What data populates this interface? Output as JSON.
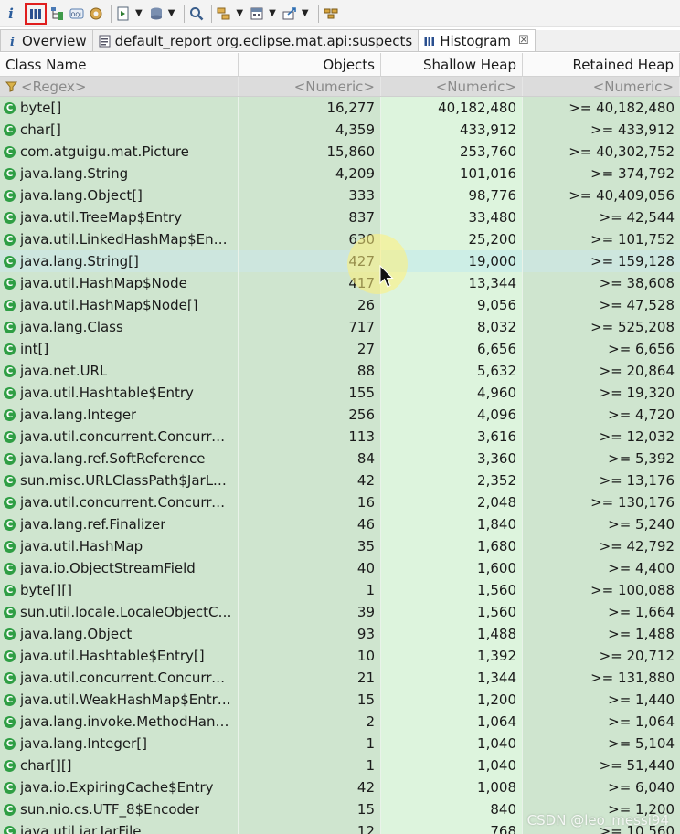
{
  "toolbar": {
    "info_label": "i",
    "buttons": [
      "histogram-icon",
      "dominator-tree-icon",
      "oql-icon",
      "settings-icon",
      "run-report-icon",
      "query-browser-icon",
      "search-icon",
      "group-icon",
      "calculator-icon",
      "export-icon",
      "overflow-icon"
    ]
  },
  "tabs": [
    {
      "label": "Overview",
      "icon": "info-icon"
    },
    {
      "label": "default_report  org.eclipse.mat.api:suspects",
      "icon": "report-icon"
    },
    {
      "label": "Histogram",
      "icon": "histogram-icon",
      "close": "☒"
    }
  ],
  "table": {
    "columns": [
      "Class Name",
      "Objects",
      "Shallow Heap",
      "Retained Heap"
    ],
    "filters": [
      "<Regex>",
      "<Numeric>",
      "<Numeric>",
      "<Numeric>"
    ],
    "rows": [
      {
        "name": "byte[]",
        "objects": "16,277",
        "shallow": "40,182,480",
        "retained": ">= 40,182,480"
      },
      {
        "name": "char[]",
        "objects": "4,359",
        "shallow": "433,912",
        "retained": ">= 433,912"
      },
      {
        "name": "com.atguigu.mat.Picture",
        "objects": "15,860",
        "shallow": "253,760",
        "retained": ">= 40,302,752"
      },
      {
        "name": "java.lang.String",
        "objects": "4,209",
        "shallow": "101,016",
        "retained": ">= 374,792"
      },
      {
        "name": "java.lang.Object[]",
        "objects": "333",
        "shallow": "98,776",
        "retained": ">= 40,409,056"
      },
      {
        "name": "java.util.TreeMap$Entry",
        "objects": "837",
        "shallow": "33,480",
        "retained": ">= 42,544"
      },
      {
        "name": "java.util.LinkedHashMap$Entry",
        "objects": "630",
        "shallow": "25,200",
        "retained": ">= 101,752"
      },
      {
        "name": "java.lang.String[]",
        "objects": "427",
        "shallow": "19,000",
        "retained": ">= 159,128"
      },
      {
        "name": "java.util.HashMap$Node",
        "objects": "417",
        "shallow": "13,344",
        "retained": ">= 38,608"
      },
      {
        "name": "java.util.HashMap$Node[]",
        "objects": "26",
        "shallow": "9,056",
        "retained": ">= 47,528"
      },
      {
        "name": "java.lang.Class",
        "objects": "717",
        "shallow": "8,032",
        "retained": ">= 525,208"
      },
      {
        "name": "int[]",
        "objects": "27",
        "shallow": "6,656",
        "retained": ">= 6,656"
      },
      {
        "name": "java.net.URL",
        "objects": "88",
        "shallow": "5,632",
        "retained": ">= 20,864"
      },
      {
        "name": "java.util.Hashtable$Entry",
        "objects": "155",
        "shallow": "4,960",
        "retained": ">= 19,320"
      },
      {
        "name": "java.lang.Integer",
        "objects": "256",
        "shallow": "4,096",
        "retained": ">= 4,720"
      },
      {
        "name": "java.util.concurrent.Concurren...",
        "objects": "113",
        "shallow": "3,616",
        "retained": ">= 12,032"
      },
      {
        "name": "java.lang.ref.SoftReference",
        "objects": "84",
        "shallow": "3,360",
        "retained": ">= 5,392"
      },
      {
        "name": "sun.misc.URLClassPath$JarLoa...",
        "objects": "42",
        "shallow": "2,352",
        "retained": ">= 13,176"
      },
      {
        "name": "java.util.concurrent.Concurren...",
        "objects": "16",
        "shallow": "2,048",
        "retained": ">= 130,176"
      },
      {
        "name": "java.lang.ref.Finalizer",
        "objects": "46",
        "shallow": "1,840",
        "retained": ">= 5,240"
      },
      {
        "name": "java.util.HashMap",
        "objects": "35",
        "shallow": "1,680",
        "retained": ">= 42,792"
      },
      {
        "name": "java.io.ObjectStreamField",
        "objects": "40",
        "shallow": "1,600",
        "retained": ">= 4,400"
      },
      {
        "name": "byte[][]",
        "objects": "1",
        "shallow": "1,560",
        "retained": ">= 100,088"
      },
      {
        "name": "sun.util.locale.LocaleObjectCa...",
        "objects": "39",
        "shallow": "1,560",
        "retained": ">= 1,664"
      },
      {
        "name": "java.lang.Object",
        "objects": "93",
        "shallow": "1,488",
        "retained": ">= 1,488"
      },
      {
        "name": "java.util.Hashtable$Entry[]",
        "objects": "10",
        "shallow": "1,392",
        "retained": ">= 20,712"
      },
      {
        "name": "java.util.concurrent.Concurren...",
        "objects": "21",
        "shallow": "1,344",
        "retained": ">= 131,880"
      },
      {
        "name": "java.util.WeakHashMap$Entry[]",
        "objects": "15",
        "shallow": "1,200",
        "retained": ">= 1,440"
      },
      {
        "name": "java.lang.invoke.MethodHandl...",
        "objects": "2",
        "shallow": "1,064",
        "retained": ">= 1,064"
      },
      {
        "name": "java.lang.Integer[]",
        "objects": "1",
        "shallow": "1,040",
        "retained": ">= 5,104"
      },
      {
        "name": "char[][]",
        "objects": "1",
        "shallow": "1,040",
        "retained": ">= 51,440"
      },
      {
        "name": "java.io.ExpiringCache$Entry",
        "objects": "42",
        "shallow": "1,008",
        "retained": ">= 6,040"
      },
      {
        "name": "sun.nio.cs.UTF_8$Encoder",
        "objects": "15",
        "shallow": "840",
        "retained": ">= 1,200"
      },
      {
        "name": "java.util.jar.JarFile",
        "objects": "12",
        "shallow": "768",
        "retained": ">= 10,560"
      }
    ],
    "selected_row": "java.lang.String[]"
  },
  "watermark": "CSDN @leo_messi94",
  "colors": {
    "row_bg": "#cfe5cf",
    "highlight_col": "#ddf4dd",
    "selection_border": "#e01e1e"
  }
}
